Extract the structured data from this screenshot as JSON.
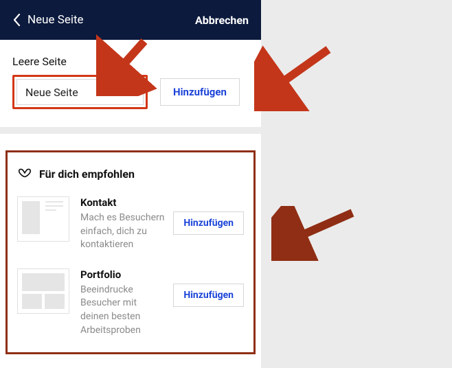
{
  "header": {
    "title": "Neue Seite",
    "cancel": "Abbrechen"
  },
  "blank": {
    "label": "Leere Seite",
    "input_value": "Neue Seite",
    "add": "Hinzufügen"
  },
  "recommended": {
    "title": "Für dich empfohlen",
    "items": [
      {
        "name": "Kontakt",
        "desc": "Mach es Besuchern einfach, dich zu kontaktieren",
        "add": "Hinzufügen"
      },
      {
        "name": "Portfolio",
        "desc": "Beeindrucke Besucher mit deinen besten Arbeitsproben",
        "add": "Hinzufügen"
      }
    ]
  }
}
